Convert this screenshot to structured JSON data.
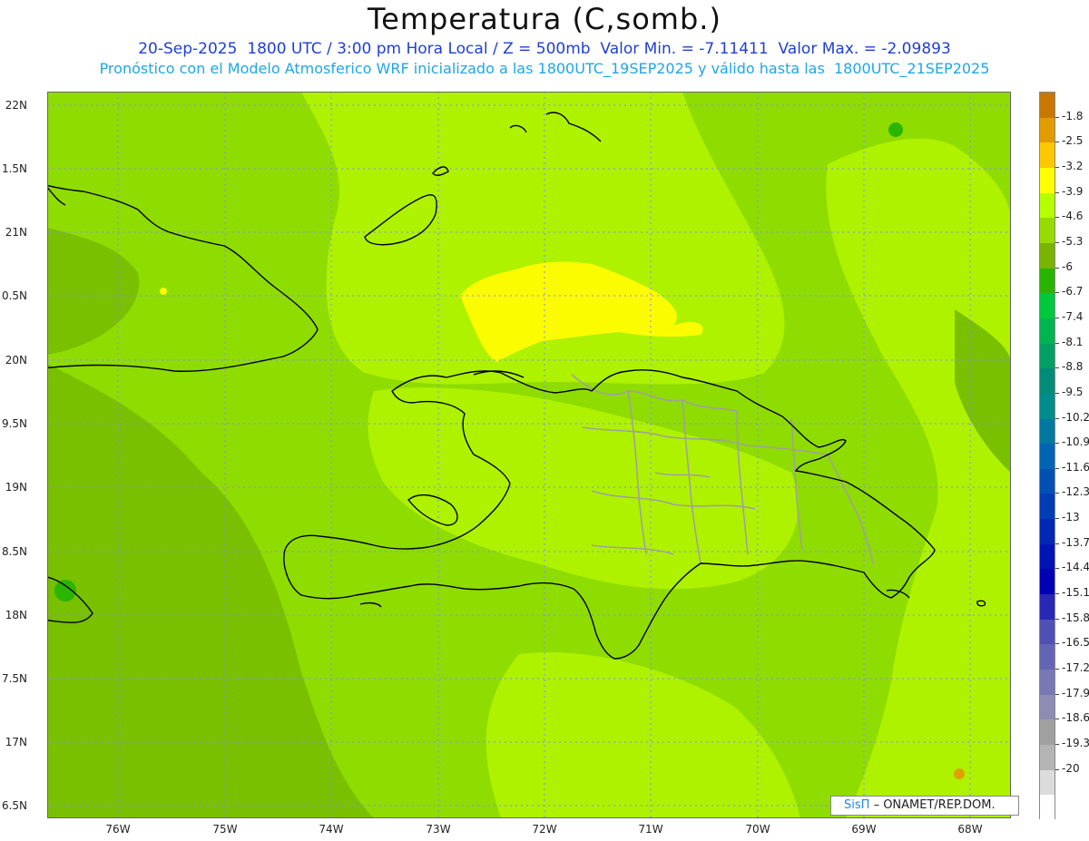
{
  "header": {
    "title": "Temperatura (C,somb.)",
    "line1": "20-Sep-2025  1800 UTC / 3:00 pm Hora Local / Z = 500mb  Valor Min. = -7.11411  Valor Max. = -2.09893",
    "line2": "Pronóstico con el Modelo Atmosferico WRF inicializado a las 1800UTC_19SEP2025 y válido hasta las  1800UTC_21SEP2025"
  },
  "axes": {
    "lat_labels": [
      "22N",
      "1.5N",
      "21N",
      "0.5N",
      "20N",
      "9.5N",
      "19N",
      "8.5N",
      "18N",
      "7.5N",
      "17N",
      "6.5N"
    ],
    "lon_labels": [
      "76W",
      "75W",
      "74W",
      "73W",
      "72W",
      "71W",
      "70W",
      "69W",
      "68W"
    ]
  },
  "colorbar": {
    "labels": [
      "-1.8",
      "-2.5",
      "-3.2",
      "-3.9",
      "-4.6",
      "-5.3",
      "-6",
      "-6.7",
      "-7.4",
      "-8.1",
      "-8.8",
      "-9.5",
      "-10.2",
      "-10.9",
      "-11.6",
      "-12.3",
      "-13",
      "-13.7",
      "-14.4",
      "-15.1",
      "-15.8",
      "-16.5",
      "-17.2",
      "-17.9",
      "-18.6",
      "-19.3",
      "-20"
    ],
    "colors": [
      "#c87800",
      "#e09c00",
      "#ffc800",
      "#ffff00",
      "#b4ff00",
      "#96dc00",
      "#78b400",
      "#28b400",
      "#00c83c",
      "#00b450",
      "#00a064",
      "#008c78",
      "#008c8c",
      "#0078a0",
      "#0064b4",
      "#0050b4",
      "#003cb4",
      "#0028b4",
      "#0014b4",
      "#0000b4",
      "#2828b4",
      "#5050b4",
      "#6464b4",
      "#7878b4",
      "#8c8cb4",
      "#a0a0a0",
      "#b4b4b4",
      "#dcdcdc",
      "#ffffff"
    ]
  },
  "map_colors": {
    "warm": "#fcfc00",
    "light": "#aef200",
    "mid": "#8fdc00",
    "dark": "#78c000",
    "green": "#2bb400",
    "orange": "#e0a000",
    "coast": "#000000",
    "provinces": "#a0a0a0",
    "grid": "#8888ff"
  },
  "credit": {
    "brand": "SisΠ",
    "text": "– ONAMET/REP.DOM."
  }
}
